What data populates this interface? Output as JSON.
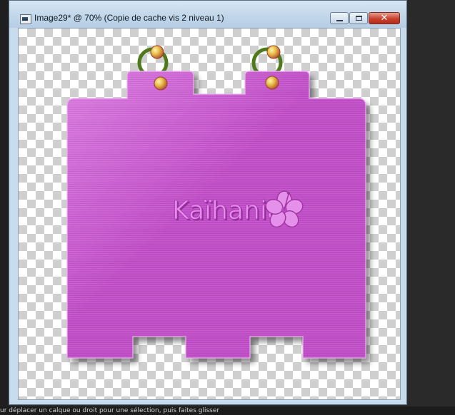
{
  "window": {
    "title": "Image29* @  70% (Copie de cache vis 2 niveau 1)",
    "icon": "image-document-icon",
    "buttons": {
      "minimize": "minimize-icon",
      "maximize": "maximize-icon",
      "close_label": "✕"
    }
  },
  "canvas": {
    "background": "transparency-checkerboard",
    "tag": {
      "color": "#c24fc9",
      "highlight": "#dd7ee3",
      "logo_text": "Kaïhania",
      "logo_icon": "hibiscus-flower-icon",
      "ring_color": "#4f7a1c",
      "bead_color": "#e8c04a"
    }
  },
  "status": {
    "text": "ur déplacer un calque ou droit pour une sélection, puis faites glisser"
  }
}
